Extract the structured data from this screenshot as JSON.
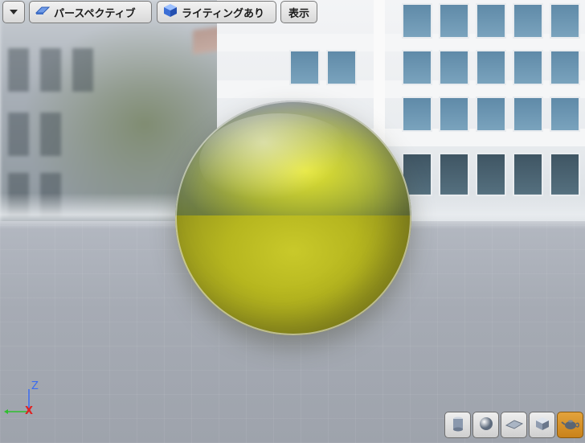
{
  "toolbar": {
    "perspective_label": "パースペクティブ",
    "lighting_label": "ライティングあり",
    "show_label": "表示"
  },
  "axis": {
    "z_label": "Z",
    "x_label": "X",
    "colors": {
      "z": "#3a6cf0",
      "x": "#e02020",
      "y": "#2fbf2f"
    }
  },
  "view_buttons": [
    {
      "name": "unlit-cylinder",
      "icon": "cylinder-icon",
      "active": false
    },
    {
      "name": "sphere-preview",
      "icon": "sphere-icon",
      "active": false
    },
    {
      "name": "plane-preview",
      "icon": "plane-icon",
      "active": false
    },
    {
      "name": "cube-preview",
      "icon": "cube-icon",
      "active": false
    },
    {
      "name": "teapot-preview",
      "icon": "teapot-icon",
      "active": true
    }
  ],
  "colors": {
    "accent_active": "#d9902a",
    "material": "#c2c21f"
  }
}
